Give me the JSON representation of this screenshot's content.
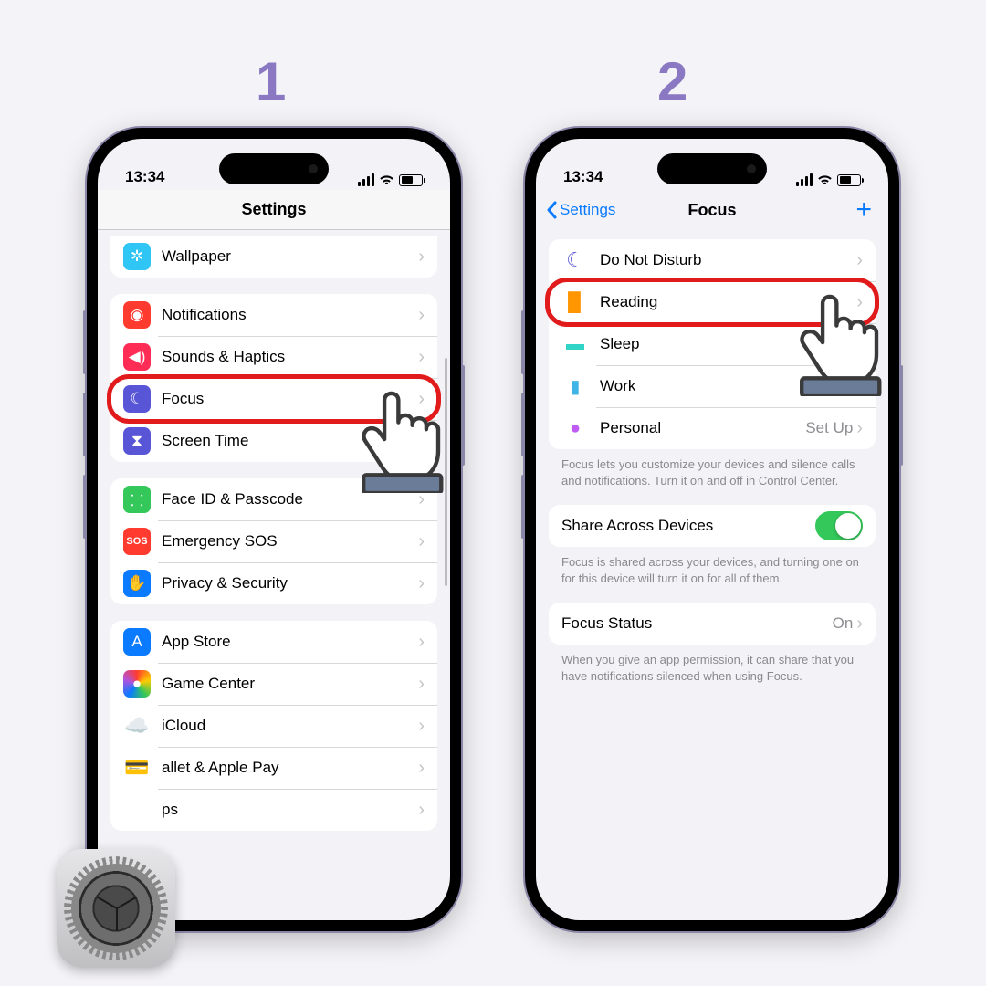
{
  "steps": {
    "one": "1",
    "two": "2"
  },
  "status": {
    "time": "13:34"
  },
  "phone1": {
    "title": "Settings",
    "groups": [
      {
        "rows": [
          {
            "label": "Wallpaper",
            "icon": "flower-icon",
            "color": "c-cyan"
          }
        ]
      },
      {
        "rows": [
          {
            "label": "Notifications",
            "icon": "bell-icon",
            "color": "c-red"
          },
          {
            "label": "Sounds & Haptics",
            "icon": "speaker-icon",
            "color": "c-pink"
          },
          {
            "label": "Focus",
            "icon": "moon-icon",
            "color": "c-indigo",
            "highlight": true
          },
          {
            "label": "Screen Time",
            "icon": "hourglass-icon",
            "color": "c-indigo"
          }
        ]
      },
      {
        "rows": [
          {
            "label": "Face ID & Passcode",
            "icon": "faceid-icon",
            "color": "c-darkgreen"
          },
          {
            "label": "Emergency SOS",
            "icon": "sos-icon",
            "color": "c-sos",
            "text": "SOS"
          },
          {
            "label": "Privacy & Security",
            "icon": "hand-icon",
            "color": "c-blue"
          }
        ]
      },
      {
        "rows": [
          {
            "label": "App Store",
            "icon": "appstore-icon",
            "color": "c-blue"
          },
          {
            "label": "Game Center",
            "icon": "gamecenter-icon",
            "color": "multicolor"
          },
          {
            "label": "iCloud",
            "icon": "icloud-icon",
            "color": "",
            "glyph": "☁️"
          },
          {
            "label": "allet & Apple Pay",
            "icon": "wallet-icon",
            "color": "",
            "glyph": "💳",
            "clipped": true
          },
          {
            "label": "ps",
            "icon": "",
            "clipped": true
          }
        ]
      }
    ]
  },
  "phone2": {
    "back": "Settings",
    "title": "Focus",
    "focuses": [
      {
        "label": "Do Not Disturb",
        "iconClass": "plain-moon",
        "glyph": "☾"
      },
      {
        "label": "Reading",
        "iconClass": "plain-book",
        "glyph": "▉",
        "highlight": true
      },
      {
        "label": "Sleep",
        "iconClass": "plain-bed",
        "glyph": "▬"
      },
      {
        "label": "Work",
        "iconClass": "plain-work",
        "glyph": "▮"
      },
      {
        "label": "Personal",
        "iconClass": "plain-person",
        "glyph": "●",
        "detail": "Set Up"
      }
    ],
    "focus_footer": "Focus lets you customize your devices and silence calls and notifications. Turn it on and off in Control Center.",
    "share": {
      "label": "Share Across Devices"
    },
    "share_footer": "Focus is shared across your devices, and turning one on for this device will turn it on for all of them.",
    "status_row": {
      "label": "Focus Status",
      "detail": "On"
    },
    "status_footer": "When you give an app permission, it can share that you have notifications silenced when using Focus."
  }
}
